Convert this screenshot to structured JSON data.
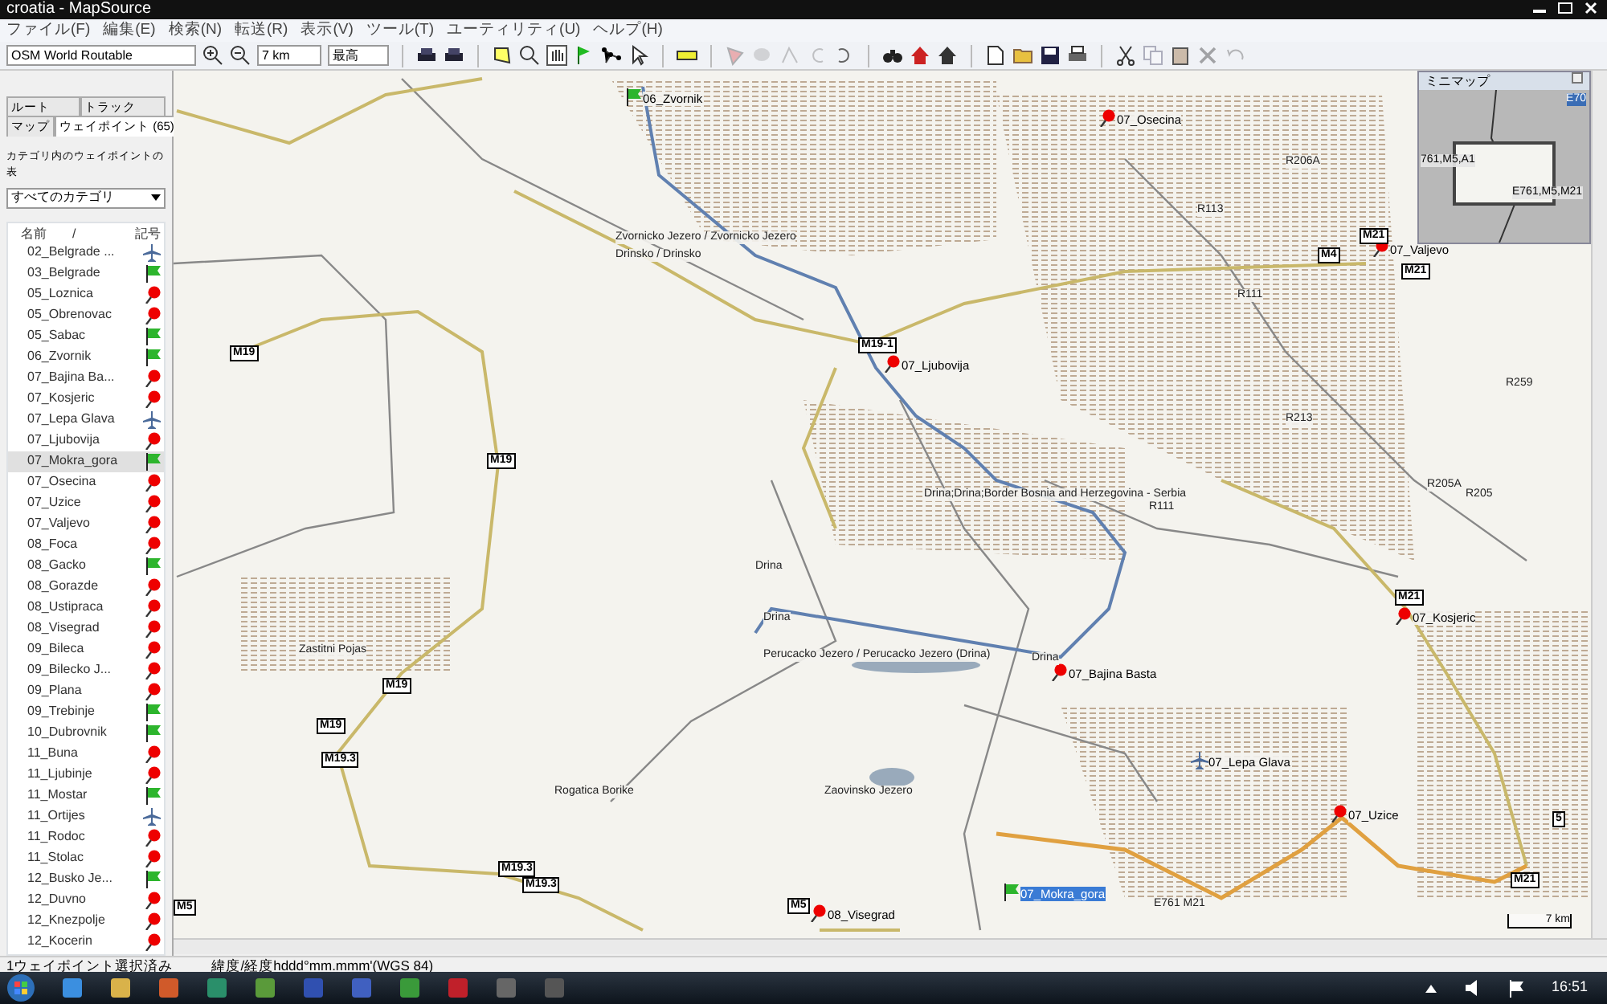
{
  "window": {
    "title": "croatia - MapSource"
  },
  "menu": [
    "ファイル(F)",
    "編集(E)",
    "検索(N)",
    "転送(R)",
    "表示(V)",
    "ツール(T)",
    "ユーティリティ(U)",
    "ヘルプ(H)"
  ],
  "toolbar": {
    "map_product": "OSM World Routable",
    "zoom": "7 km",
    "detail": "最高",
    "buttons": [
      {
        "disabled": false
      },
      {
        "disabled": false
      },
      {
        "disabled": false
      },
      {
        "disabled": false
      },
      {
        "disabled": false
      },
      {
        "disabled": false
      },
      {
        "disabled": false
      },
      {
        "disabled": false
      },
      {
        "disabled": false
      },
      {
        "disabled": false
      },
      {
        "disabled": false
      },
      {
        "disabled": true
      },
      {
        "disabled": true
      },
      {
        "disabled": true
      },
      {
        "disabled": true
      },
      {
        "disabled": false
      },
      {
        "disabled": false
      },
      {
        "disabled": false
      },
      {
        "disabled": false
      },
      {
        "disabled": false
      },
      {
        "disabled": false
      },
      {
        "disabled": false
      },
      {
        "disabled": false
      },
      {
        "disabled": false
      },
      {
        "disabled": true
      },
      {
        "disabled": false
      },
      {
        "disabled": true
      },
      {
        "disabled": true
      }
    ]
  },
  "tabs_top": [
    {
      "label": "ルート",
      "selected": false
    },
    {
      "label": "トラック",
      "selected": false
    }
  ],
  "tabs_bottom": [
    {
      "label": "マップ",
      "selected": false
    },
    {
      "label": "ウェイポイント (65)",
      "selected": true
    }
  ],
  "category": {
    "label": "カテゴリ内のウェイポイントの表",
    "value": "すべてのカテゴリ"
  },
  "waypoints": {
    "columns": [
      "名前",
      "/",
      "記号"
    ],
    "rows": [
      {
        "name": "02_Belgrade ...",
        "kind": "plane",
        "selected": false
      },
      {
        "name": "03_Belgrade",
        "kind": "flag",
        "selected": false
      },
      {
        "name": "05_Loznica",
        "kind": "pin",
        "selected": false
      },
      {
        "name": "05_Obrenovac",
        "kind": "pin",
        "selected": false
      },
      {
        "name": "05_Sabac",
        "kind": "flag",
        "selected": false
      },
      {
        "name": "06_Zvornik",
        "kind": "flag",
        "selected": false
      },
      {
        "name": "07_Bajina Ba...",
        "kind": "pin",
        "selected": false
      },
      {
        "name": "07_Kosjeric",
        "kind": "pin",
        "selected": false
      },
      {
        "name": "07_Lepa Glava",
        "kind": "plane",
        "selected": false
      },
      {
        "name": "07_Ljubovija",
        "kind": "pin",
        "selected": false
      },
      {
        "name": "07_Mokra_gora",
        "kind": "flag",
        "selected": true
      },
      {
        "name": "07_Osecina",
        "kind": "pin",
        "selected": false
      },
      {
        "name": "07_Uzice",
        "kind": "pin",
        "selected": false
      },
      {
        "name": "07_Valjevo",
        "kind": "pin",
        "selected": false
      },
      {
        "name": "08_Foca",
        "kind": "pin",
        "selected": false
      },
      {
        "name": "08_Gacko",
        "kind": "flag",
        "selected": false
      },
      {
        "name": "08_Gorazde",
        "kind": "pin",
        "selected": false
      },
      {
        "name": "08_Ustipraca",
        "kind": "pin",
        "selected": false
      },
      {
        "name": "08_Visegrad",
        "kind": "pin",
        "selected": false
      },
      {
        "name": "09_Bileca",
        "kind": "pin",
        "selected": false
      },
      {
        "name": "09_Bilecko J...",
        "kind": "pin",
        "selected": false
      },
      {
        "name": "09_Plana",
        "kind": "pin",
        "selected": false
      },
      {
        "name": "09_Trebinje",
        "kind": "flag",
        "selected": false
      },
      {
        "name": "10_Dubrovnik",
        "kind": "flag",
        "selected": false
      },
      {
        "name": "11_Buna",
        "kind": "pin",
        "selected": false
      },
      {
        "name": "11_Ljubinje",
        "kind": "pin",
        "selected": false
      },
      {
        "name": "11_Mostar",
        "kind": "flag",
        "selected": false
      },
      {
        "name": "11_Ortijes",
        "kind": "plane",
        "selected": false
      },
      {
        "name": "11_Rodoc",
        "kind": "pin",
        "selected": false
      },
      {
        "name": "11_Stolac",
        "kind": "pin",
        "selected": false
      },
      {
        "name": "12_Busko Je...",
        "kind": "flag",
        "selected": false
      },
      {
        "name": "12_Duvno",
        "kind": "pin",
        "selected": false
      },
      {
        "name": "12_Knezpolje",
        "kind": "pin",
        "selected": false
      },
      {
        "name": "12_Kocerin",
        "kind": "pin",
        "selected": false
      }
    ]
  },
  "map": {
    "points": [
      {
        "label": "06_Zvornik",
        "kind": "flag",
        "selected": false
      },
      {
        "label": "07_Osecina",
        "kind": "pin",
        "selected": false
      },
      {
        "label": "07_Valjevo",
        "kind": "pin",
        "selected": false
      },
      {
        "label": "07_Ljubovija",
        "kind": "pin",
        "selected": false
      },
      {
        "label": "07_Kosjeric",
        "kind": "pin",
        "selected": false
      },
      {
        "label": "07_Bajina Basta",
        "kind": "pin",
        "selected": false
      },
      {
        "label": "07_Lepa Glava",
        "kind": "plane",
        "selected": false
      },
      {
        "label": "07_Uzice",
        "kind": "pin",
        "selected": false
      },
      {
        "label": "07_Mokra_gora",
        "kind": "flag",
        "selected": true
      },
      {
        "label": "08_Visegrad",
        "kind": "pin",
        "selected": false
      }
    ],
    "shields": [
      "M19",
      "M19",
      "M19-1",
      "M19",
      "M19",
      "M19.3",
      "M19.3",
      "M19.3",
      "M5",
      "M5",
      "M4",
      "M21",
      "M21",
      "M21",
      "M21",
      "5"
    ],
    "labels": [
      "R206A",
      "R113",
      "R111",
      "R213",
      "R259",
      "R111",
      "R205A",
      "R205",
      "Drina",
      "Drina",
      "Zvornicko Jezero / Zvornicko Jezero",
      "Drinsko / Drinsko",
      "Perucacko Jezero / Perucacko Jezero (Drina)",
      "Zaovinsko Jezero",
      "Zastitni Pojas",
      "Rogatica Borike",
      "Drina;Drina;Border Bosnia and Herzegovina - Serbia",
      "Drina",
      "E761 M21"
    ],
    "scale": "7 km"
  },
  "minimap": {
    "title": "ミニマップ",
    "labels": [
      "E70",
      "761,M5,A1",
      "E761,M5,M21"
    ]
  },
  "status": [
    "1ウェイポイント選択済み",
    "緯度/経度hddd°mm.mmm'(WGS 84)"
  ],
  "taskbar": {
    "clock": "16:51"
  }
}
